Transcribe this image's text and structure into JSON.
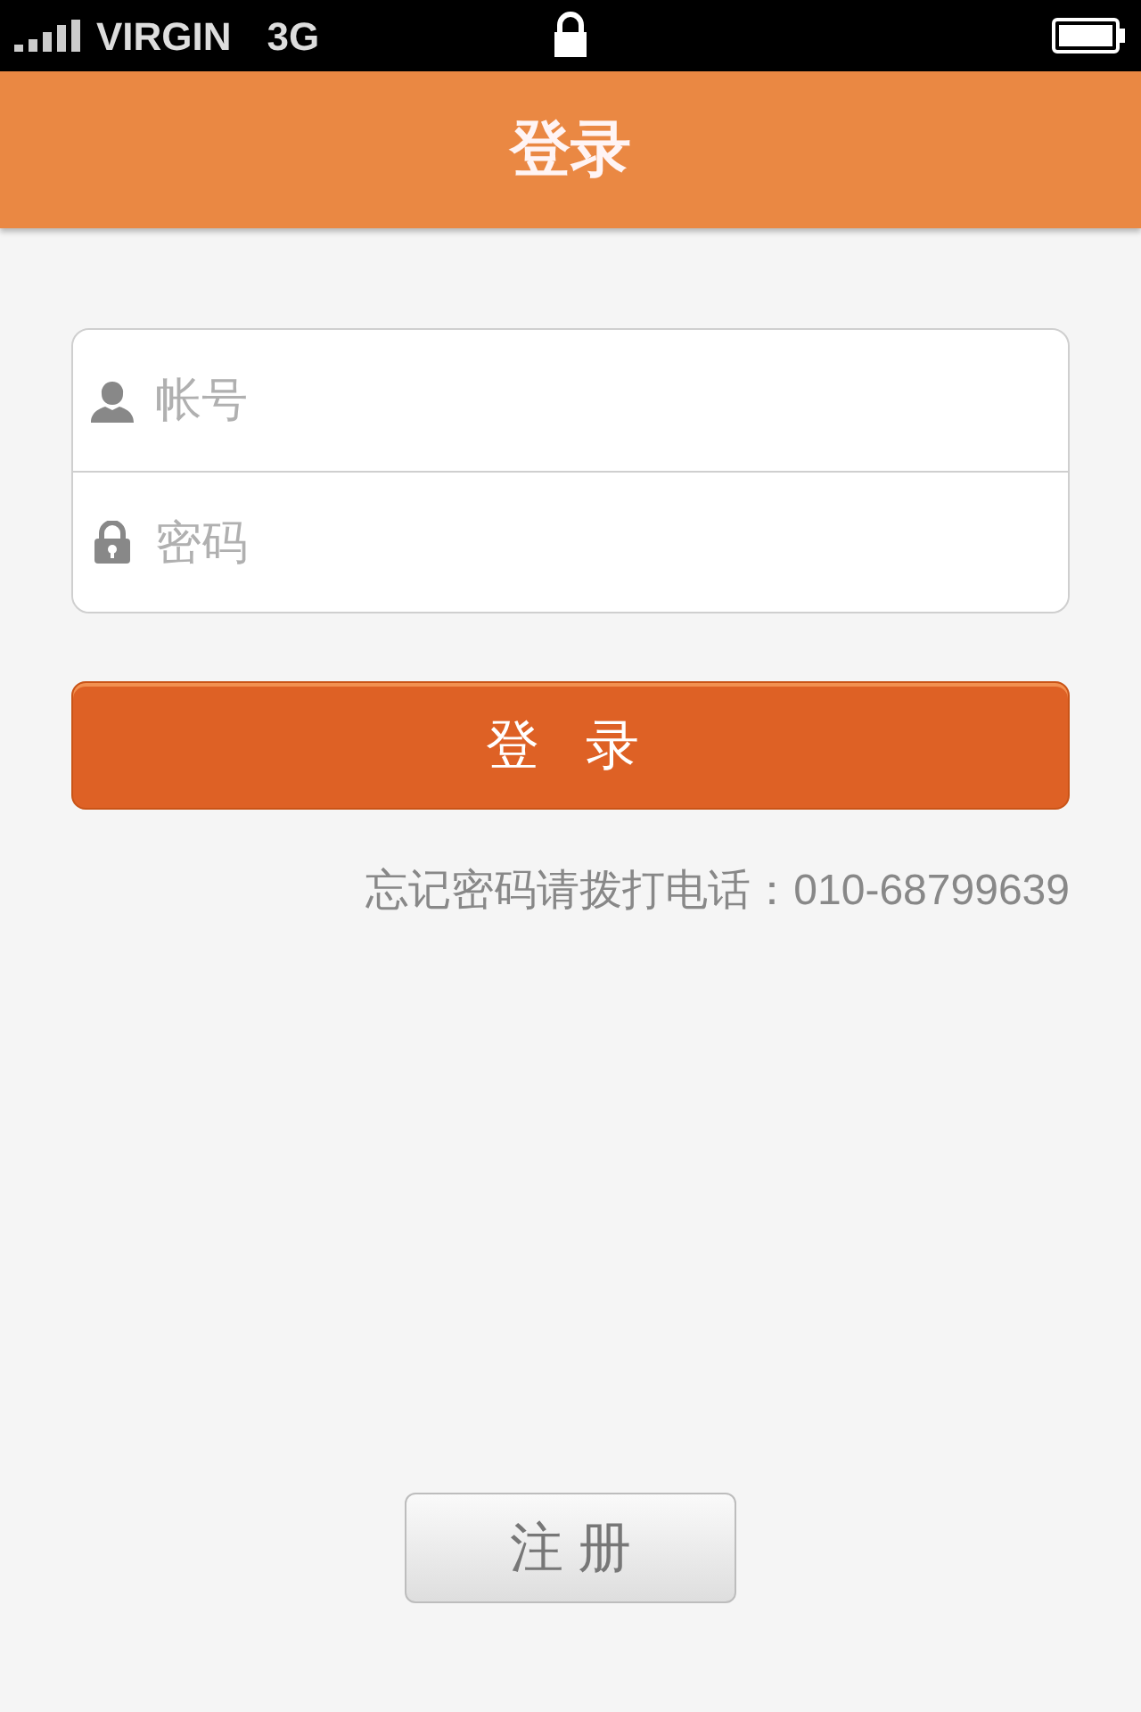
{
  "status_bar": {
    "carrier": "VIRGIN",
    "network": "3G"
  },
  "header": {
    "title": "登录"
  },
  "fields": [
    {
      "kind": "user",
      "placeholder": "帐号"
    },
    {
      "kind": "lock",
      "placeholder": "密码"
    }
  ],
  "login_button": "登 录",
  "hint": "忘记密码请拨打电话：010-68799639",
  "register_button": "注 册"
}
